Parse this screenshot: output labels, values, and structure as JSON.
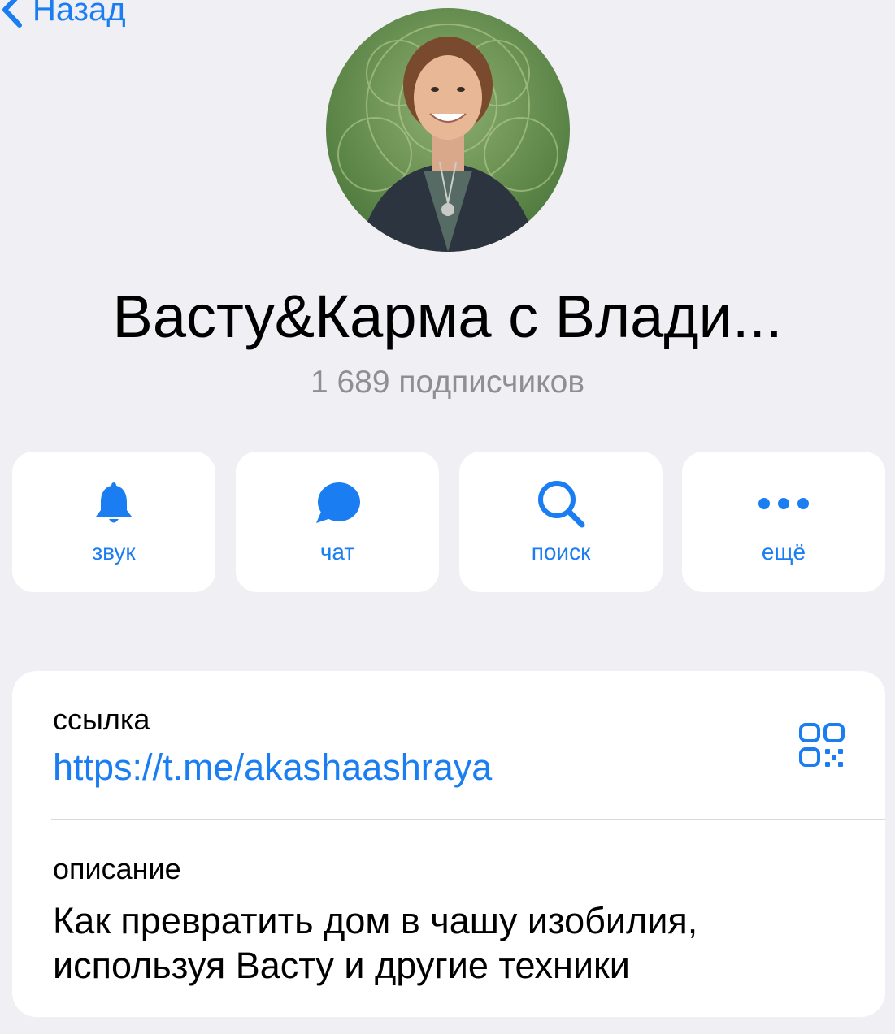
{
  "nav": {
    "back_label": "Назад"
  },
  "channel": {
    "title": "Васту&Карма с Влади...",
    "subscribers": "1 689 подписчиков"
  },
  "actions": [
    {
      "icon": "bell-icon",
      "label": "звук"
    },
    {
      "icon": "chat-bubble-icon",
      "label": "чат"
    },
    {
      "icon": "search-icon",
      "label": "поиск"
    },
    {
      "icon": "more-dots-icon",
      "label": "ещё"
    }
  ],
  "info": {
    "link_label": "ссылка",
    "link_value": "https://t.me/akashaashraya",
    "description_label": "описание",
    "description_value": "Как превратить дом в чашу изобилия, используя Васту и другие техники"
  },
  "colors": {
    "accent": "#1a7ef2",
    "background": "#efeff4",
    "card": "#ffffff",
    "secondary_text": "#8e8e93"
  }
}
